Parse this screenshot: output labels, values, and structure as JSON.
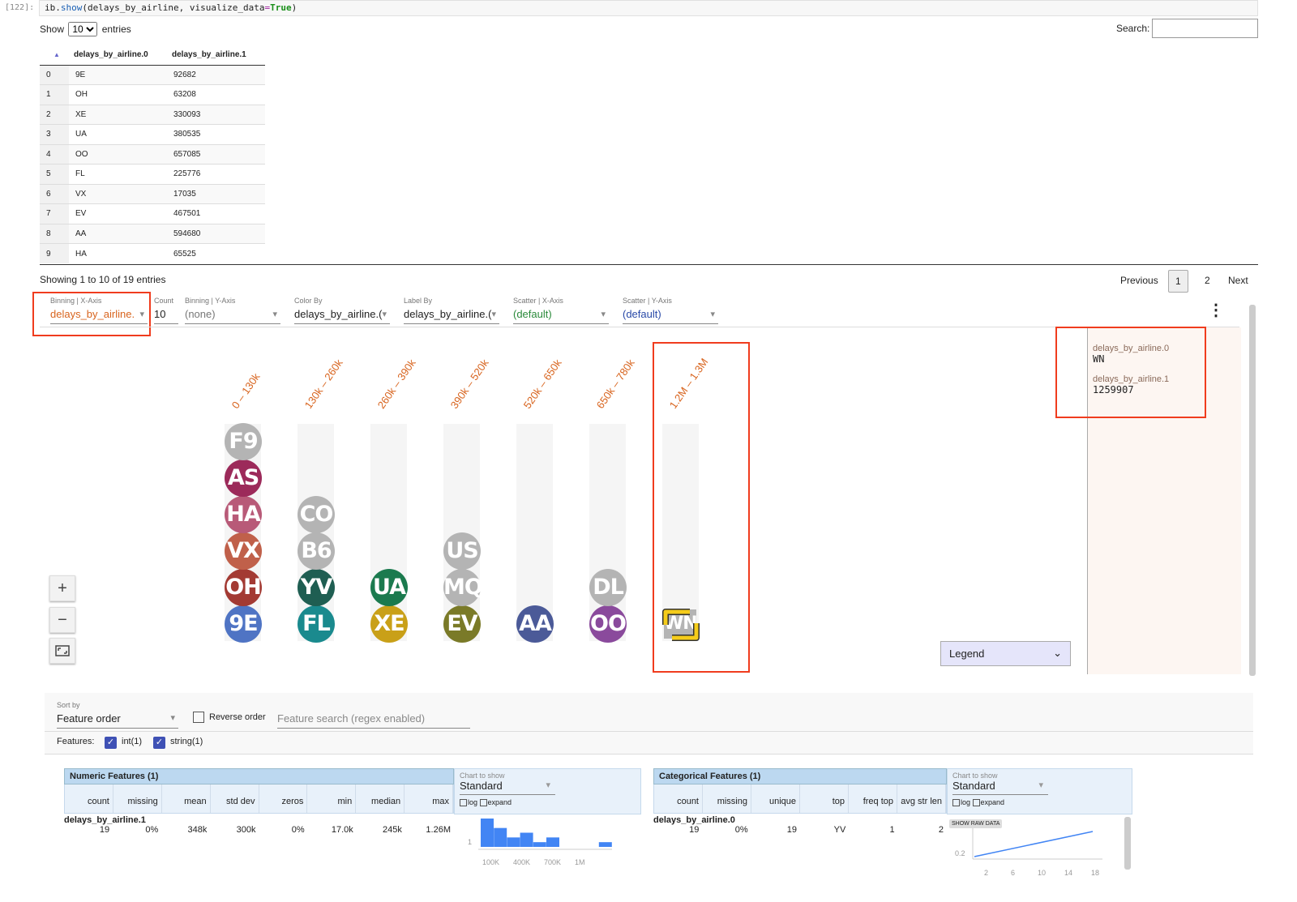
{
  "cell": {
    "prompt": "[122]:",
    "code_obj": "ib.",
    "code_fn": "show",
    "code_args": "(delays_by_airline, visualize_data",
    "code_eq": "=",
    "code_true": "True",
    "code_end": ")"
  },
  "table": {
    "show_label": "Show",
    "entries_label": "entries",
    "page_size": "10",
    "search_label": "Search:",
    "search_value": "",
    "columns": [
      "delays_by_airline.0",
      "delays_by_airline.1"
    ],
    "rows": [
      [
        "0",
        "9E",
        "92682"
      ],
      [
        "1",
        "OH",
        "63208"
      ],
      [
        "2",
        "XE",
        "330093"
      ],
      [
        "3",
        "UA",
        "380535"
      ],
      [
        "4",
        "OO",
        "657085"
      ],
      [
        "5",
        "FL",
        "225776"
      ],
      [
        "6",
        "VX",
        "17035"
      ],
      [
        "7",
        "EV",
        "467501"
      ],
      [
        "8",
        "AA",
        "594680"
      ],
      [
        "9",
        "HA",
        "65525"
      ]
    ],
    "info": "Showing 1 to 10 of 19 entries",
    "pagination": {
      "previous": "Previous",
      "pages": [
        "1",
        "2"
      ],
      "current": "1",
      "next": "Next"
    }
  },
  "dive": {
    "controls": [
      {
        "label": "Binning | X-Axis",
        "value": "delays_by_airline.",
        "color": "#d8641e"
      },
      {
        "label": "Count",
        "value": "10",
        "color": "#222"
      },
      {
        "label": "Binning | Y-Axis",
        "value": "(none)",
        "color": "#777"
      },
      {
        "label": "Color By",
        "value": "delays_by_airline.(",
        "color": "#222"
      },
      {
        "label": "Label By",
        "value": "delays_by_airline.(",
        "color": "#222"
      },
      {
        "label": "Scatter | X-Axis",
        "value": "(default)",
        "color": "#2a8a3a"
      },
      {
        "label": "Scatter | Y-Axis",
        "value": "(default)",
        "color": "#2a4aa8"
      }
    ],
    "bins": [
      {
        "label": "0 – 130k",
        "items": [
          {
            "t": "9E",
            "c": "#4f74c4"
          },
          {
            "t": "OH",
            "c": "#a33a33"
          },
          {
            "t": "VX",
            "c": "#c0604a"
          },
          {
            "t": "HA",
            "c": "#b85a78"
          },
          {
            "t": "AS",
            "c": "#9c2a5a"
          },
          {
            "t": "F9",
            "c": "#b4b4b4"
          }
        ]
      },
      {
        "label": "130k – 260k",
        "items": [
          {
            "t": "FL",
            "c": "#1a8a8e"
          },
          {
            "t": "YV",
            "c": "#1f5e52"
          },
          {
            "t": "B6",
            "c": "#b4b4b4"
          },
          {
            "t": "CO",
            "c": "#b4b4b4"
          }
        ]
      },
      {
        "label": "260k – 390k",
        "items": [
          {
            "t": "XE",
            "c": "#c9a018"
          },
          {
            "t": "UA",
            "c": "#1b7a4e"
          }
        ]
      },
      {
        "label": "390k – 520k",
        "items": [
          {
            "t": "EV",
            "c": "#7a7a28"
          },
          {
            "t": "MQ",
            "c": "#b4b4b4"
          },
          {
            "t": "US",
            "c": "#b4b4b4"
          }
        ]
      },
      {
        "label": "520k – 650k",
        "items": [
          {
            "t": "AA",
            "c": "#4b5a98"
          }
        ]
      },
      {
        "label": "650k – 780k",
        "items": [
          {
            "t": "OO",
            "c": "#8a4a9c"
          },
          {
            "t": "DL",
            "c": "#b4b4b4"
          }
        ]
      },
      {
        "label": "1.2M – 1.3M",
        "items": [
          {
            "t": "WN",
            "c": "#b4b4b4",
            "selected": true
          }
        ]
      }
    ],
    "legend_label": "Legend",
    "selected": {
      "field0_label": "delays_by_airline.0",
      "field0_value": "WN",
      "field1_label": "delays_by_airline.1",
      "field1_value": "1259907"
    },
    "icons": {
      "zoom_in": "+",
      "zoom_out": "−",
      "fit": "fit-screen-icon",
      "menu": "⋮"
    }
  },
  "overview": {
    "sort_label": "Sort by",
    "sort_value": "Feature order",
    "reverse_label": "Reverse order",
    "search_placeholder": "Feature search (regex enabled)",
    "features_label": "Features:",
    "feature_types": [
      "int(1)",
      "string(1)"
    ],
    "numeric": {
      "title": "Numeric Features (1)",
      "columns": [
        "count",
        "missing",
        "mean",
        "std dev",
        "zeros",
        "min",
        "median",
        "max"
      ],
      "feature": "delays_by_airline.1",
      "values": [
        "19",
        "0%",
        "348k",
        "300k",
        "0%",
        "17.0k",
        "245k",
        "1.26M"
      ],
      "chart_label": "Chart to show",
      "chart_value": "Standard",
      "log": "log",
      "expand": "expand",
      "chart_data": {
        "type": "bar",
        "values": [
          6,
          4,
          2,
          3,
          1,
          2,
          0,
          0,
          0,
          1
        ],
        "ytick": "1",
        "xticks": [
          "100K",
          "400K",
          "700K",
          "1M"
        ],
        "color": "#4285f4"
      }
    },
    "categorical": {
      "title": "Categorical Features (1)",
      "columns": [
        "count",
        "missing",
        "unique",
        "top",
        "freq top",
        "avg str len"
      ],
      "feature": "delays_by_airline.0",
      "values": [
        "19",
        "0%",
        "19",
        "YV",
        "1",
        "2"
      ],
      "chart_label": "Chart to show",
      "chart_value": "Standard",
      "log": "log",
      "expand": "expand",
      "raw_button": "SHOW RAW DATA",
      "chart_data": {
        "type": "line",
        "ytick": "0.2",
        "xticks": [
          "2",
          "6",
          "10",
          "14",
          "18"
        ],
        "color": "#4285f4"
      }
    }
  }
}
